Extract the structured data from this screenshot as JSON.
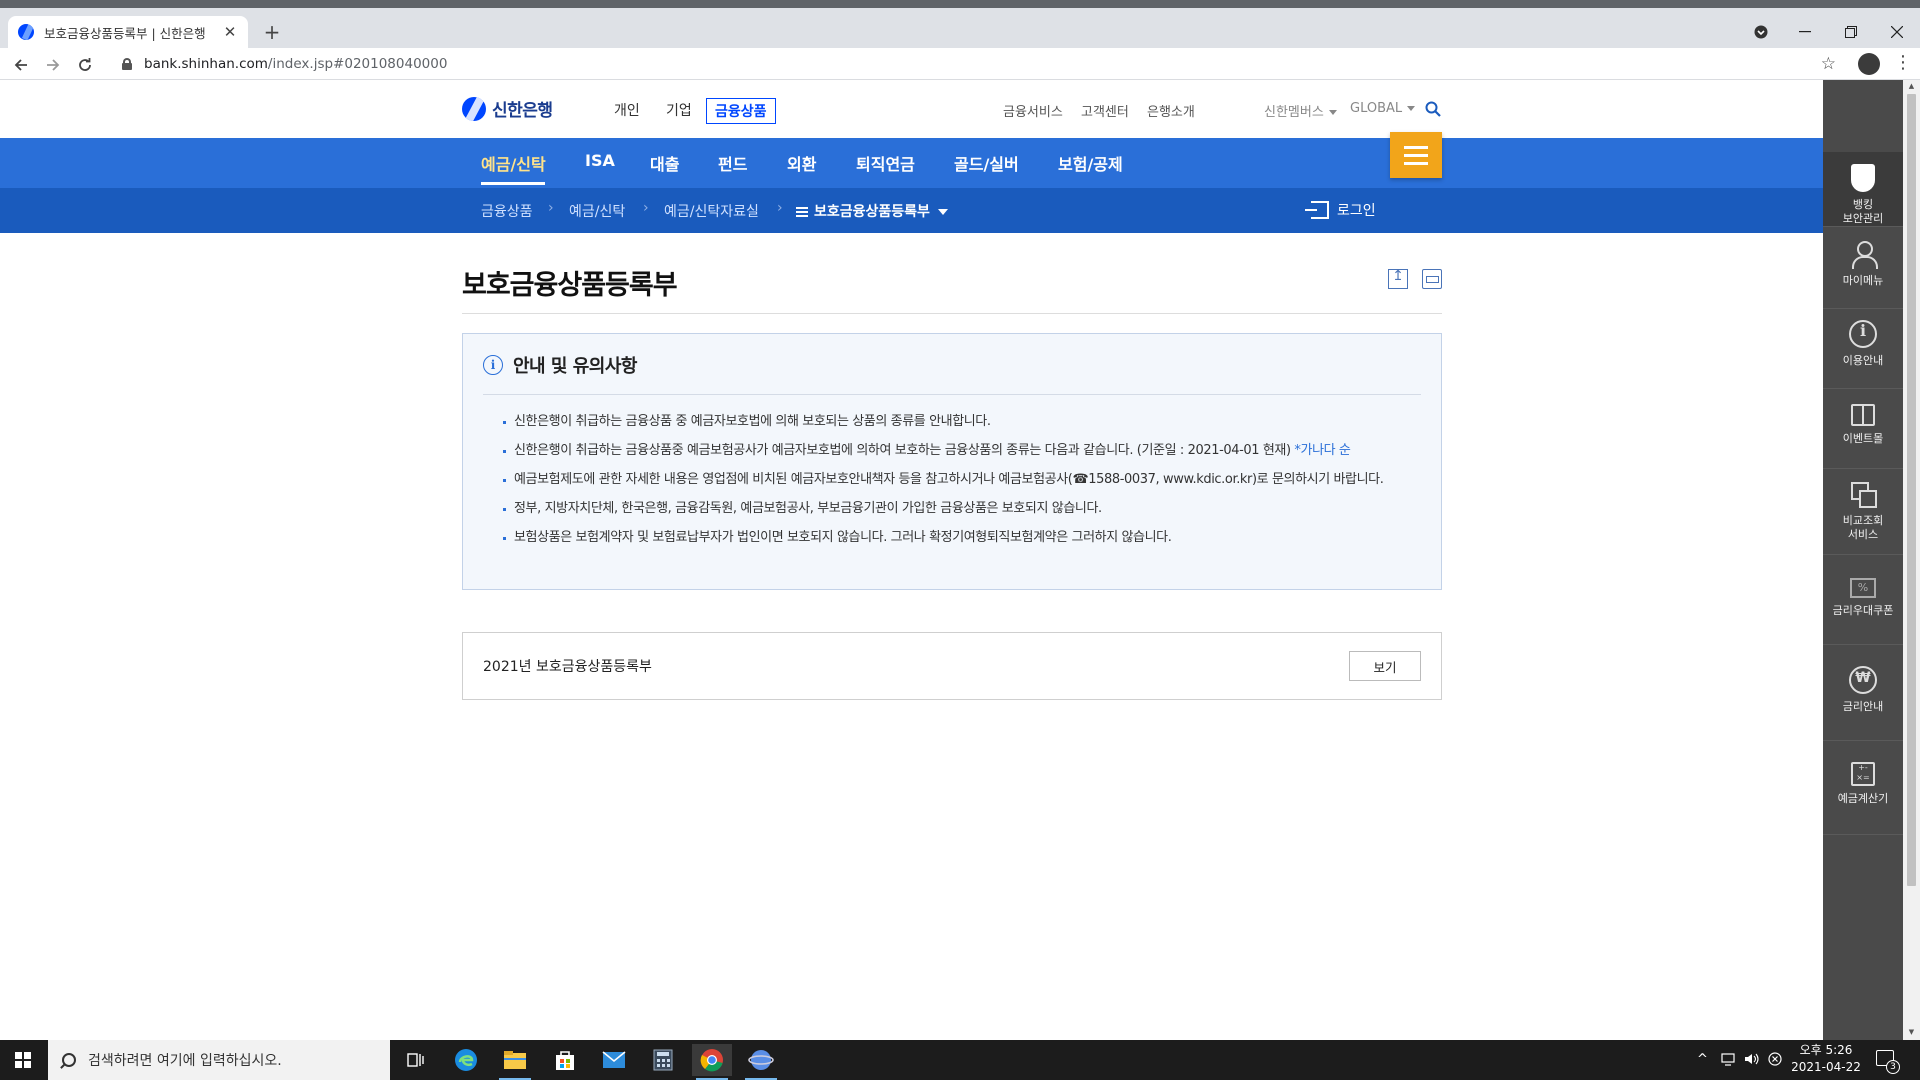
{
  "browser": {
    "tab_title": "보호금융상품등록부 | 신한은행",
    "tab_close": "✕",
    "new_tab": "+",
    "url_domain": "bank.shinhan.com",
    "url_path": "/index.jsp#020108040000",
    "icons": [
      "back-icon",
      "forward-icon",
      "reload-icon",
      "lock-icon",
      "star-icon",
      "profile-icon",
      "menu-icon"
    ]
  },
  "header": {
    "logo_text": "신한은행",
    "top_nav": [
      "개인",
      "기업",
      "금융상품"
    ],
    "active_top_nav": "금융상품",
    "util_links": [
      "금융서비스",
      "고객센터",
      "은행소개"
    ],
    "util_dropdowns": [
      "신한멤버스",
      "GLOBAL"
    ]
  },
  "lnb": {
    "items": [
      "예금/신탁",
      "ISA",
      "대출",
      "펀드",
      "외환",
      "퇴직연금",
      "골드/실버",
      "보험/공제"
    ],
    "active": "예금/신탁"
  },
  "breadcrumb": {
    "items": [
      "금융상품",
      "예금/신탁",
      "예금/신탁자료실"
    ],
    "current": "보호금융상품등록부",
    "login": "로그인"
  },
  "main": {
    "title": "보호금융상품등록부",
    "notice": {
      "title": "안내 및 유의사항",
      "items": [
        "신한은행이 취급하는 금융상품 중 예금자보호법에 의해 보호되는 상품의 종류를 안내합니다.",
        "신한은행이 취급하는 금융상품중 예금보험공사가 예금자보호법에 의하여 보호하는 금융상품의 종류는 다음과 같습니다. (기준일 : 2021-04-01 현재)",
        "예금보험제도에 관한 자세한 내용은 영업점에 비치된 예금자보호안내책자 등을 참고하시거나 예금보험공사(☎1588-0037, www.kdic.or.kr)로 문의하시기 바랍니다.",
        "정부, 지방자치단체, 한국은행, 금융감독원, 예금보험공사, 부보금융기관이 가입한 금융상품은 보호되지 않습니다.",
        "보험상품은 보험계약자 및 보험료납부자가 법인이면 보호되지 않습니다. 그러나 확정기여형퇴직보험계약은 그러하지 않습니다."
      ],
      "item2_link": "*가나다 순"
    },
    "file": {
      "name": "2021년 보호금융상품등록부",
      "button": "보기"
    }
  },
  "quick_menu": [
    {
      "line1": "뱅킹",
      "line2": "보안관리"
    },
    {
      "line1": "마이메뉴",
      "line2": ""
    },
    {
      "line1": "이용안내",
      "line2": ""
    },
    {
      "line1": "이벤트몰",
      "line2": ""
    },
    {
      "line1": "비교조회",
      "line2": "서비스"
    },
    {
      "line1": "금리우대쿠폰",
      "line2": ""
    },
    {
      "line1": "금리안내",
      "line2": ""
    },
    {
      "line1": "예금계산기",
      "line2": ""
    }
  ],
  "taskbar": {
    "search_placeholder": "검색하려면 여기에 입력하십시오.",
    "time": "오후 5:26",
    "date": "2021-04-22",
    "notification_count": "3"
  },
  "colors": {
    "brand_blue": "#2a6fd8",
    "breadcrumb_blue": "#1a5bbd",
    "accent_orange": "#f2a51a",
    "active_menu_yellow": "#ffe38a"
  }
}
